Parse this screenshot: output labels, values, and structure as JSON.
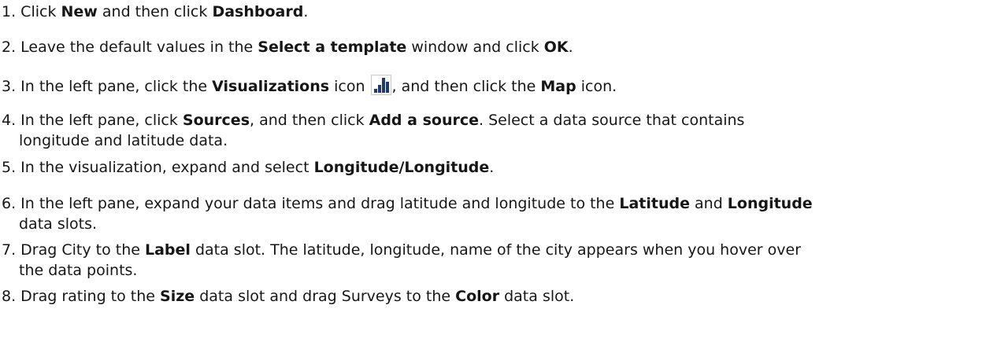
{
  "steps": [
    {
      "number": "1.",
      "parts": [
        {
          "t": "Click "
        },
        {
          "t": "New",
          "b": true
        },
        {
          "t": " and then click "
        },
        {
          "t": "Dashboard",
          "b": true
        },
        {
          "t": "."
        }
      ]
    },
    {
      "number": "2.",
      "parts": [
        {
          "t": "Leave the default values in the "
        },
        {
          "t": "Select a template",
          "b": true
        },
        {
          "t": " window and click "
        },
        {
          "t": "OK",
          "b": true
        },
        {
          "t": "."
        }
      ]
    },
    {
      "number": "3.",
      "parts": [
        {
          "t": "In the left pane, click the "
        },
        {
          "t": "Visualizations",
          "b": true
        },
        {
          "t": " icon "
        },
        {
          "icon": "visualizations-icon"
        },
        {
          "t": ", and then click the "
        },
        {
          "t": "Map",
          "b": true
        },
        {
          "t": " icon."
        }
      ]
    },
    {
      "number": "4.",
      "parts": [
        {
          "t": "In the left pane, click "
        },
        {
          "t": "Sources",
          "b": true
        },
        {
          "t": ", and then click "
        },
        {
          "t": "Add a source",
          "b": true
        },
        {
          "t": ". Select a data source that contains"
        }
      ],
      "continuation": [
        {
          "t": "longitude and latitude data."
        }
      ]
    },
    {
      "number": "5.",
      "parts": [
        {
          "t": "In the visualization, expand and select "
        },
        {
          "t": "Longitude/Longitude",
          "b": true
        },
        {
          "t": "."
        }
      ]
    },
    {
      "number": "6.",
      "parts": [
        {
          "t": "In the left pane, expand your data items and drag latitude and longitude to the "
        },
        {
          "t": "Latitude",
          "b": true
        },
        {
          "t": " and "
        },
        {
          "t": "Longitude",
          "b": true
        }
      ],
      "continuation": [
        {
          "t": "data slots."
        }
      ]
    },
    {
      "number": "7.",
      "parts": [
        {
          "t": "Drag City to the "
        },
        {
          "t": "Label",
          "b": true
        },
        {
          "t": " data slot. The latitude, longitude, name of the city appears when you hover over"
        }
      ],
      "continuation": [
        {
          "t": "the data points."
        }
      ]
    },
    {
      "number": "8.",
      "parts": [
        {
          "t": "Drag rating to the "
        },
        {
          "t": "Size",
          "b": true
        },
        {
          "t": " data slot and drag Surveys to the "
        },
        {
          "t": "Color",
          "b": true
        },
        {
          "t": " data slot."
        }
      ]
    }
  ],
  "colors": {
    "text": "#161616",
    "icon_bars": "#1f3a6e",
    "icon_background": "#ffffff"
  }
}
